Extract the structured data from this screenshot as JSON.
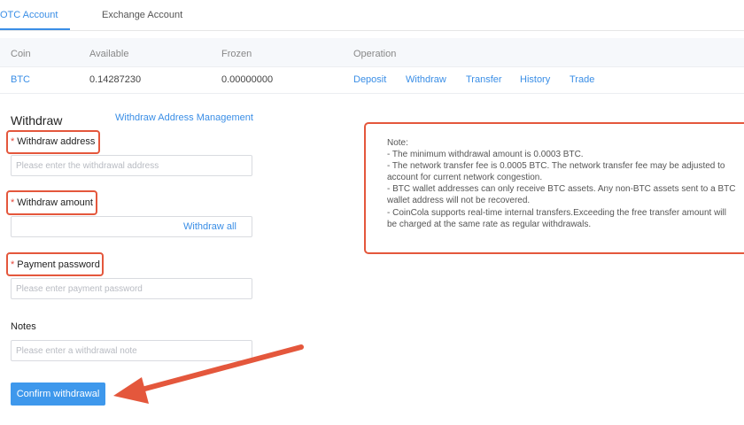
{
  "tabs": [
    {
      "label": "OTC Account",
      "active": true
    },
    {
      "label": "Exchange Account",
      "active": false
    }
  ],
  "table": {
    "headers": [
      "Coin",
      "Available",
      "Frozen",
      "Operation"
    ],
    "rows": [
      {
        "coin": "BTC",
        "available": "0.14287230",
        "frozen": "0.00000000",
        "operations": [
          "Deposit",
          "Withdraw",
          "Transfer",
          "History",
          "Trade"
        ]
      }
    ]
  },
  "form": {
    "title": "Withdraw",
    "address_management_link": "Withdraw Address Management",
    "required_mark": "*",
    "address": {
      "label": "Withdraw address",
      "placeholder": "Please enter the withdrawal address",
      "value": ""
    },
    "amount": {
      "label": "Withdraw amount",
      "value": "",
      "withdraw_all": "Withdraw all"
    },
    "password": {
      "label": "Payment password",
      "placeholder": "Please enter payment password",
      "value": ""
    },
    "notes": {
      "label": "Notes",
      "placeholder": "Please enter a withdrawal note",
      "value": ""
    },
    "confirm_label": "Confirm withdrawal"
  },
  "note": {
    "title": "Note:",
    "lines": [
      "- The minimum withdrawal amount is 0.0003 BTC.",
      "- The network transfer fee is 0.0005 BTC. The network transfer fee may be adjusted to",
      "account for current network congestion.",
      "- BTC wallet addresses can only receive BTC assets. Any non-BTC assets sent to a BTC",
      "wallet address will not be recovered.",
      "- CoinCola supports real-time internal transfers.Exceeding the free transfer amount will",
      "be charged at the same rate as regular withdrawals."
    ]
  },
  "colors": {
    "accent": "#3a8ee6",
    "highlight": "#e4573c",
    "button": "#3e98ec"
  }
}
